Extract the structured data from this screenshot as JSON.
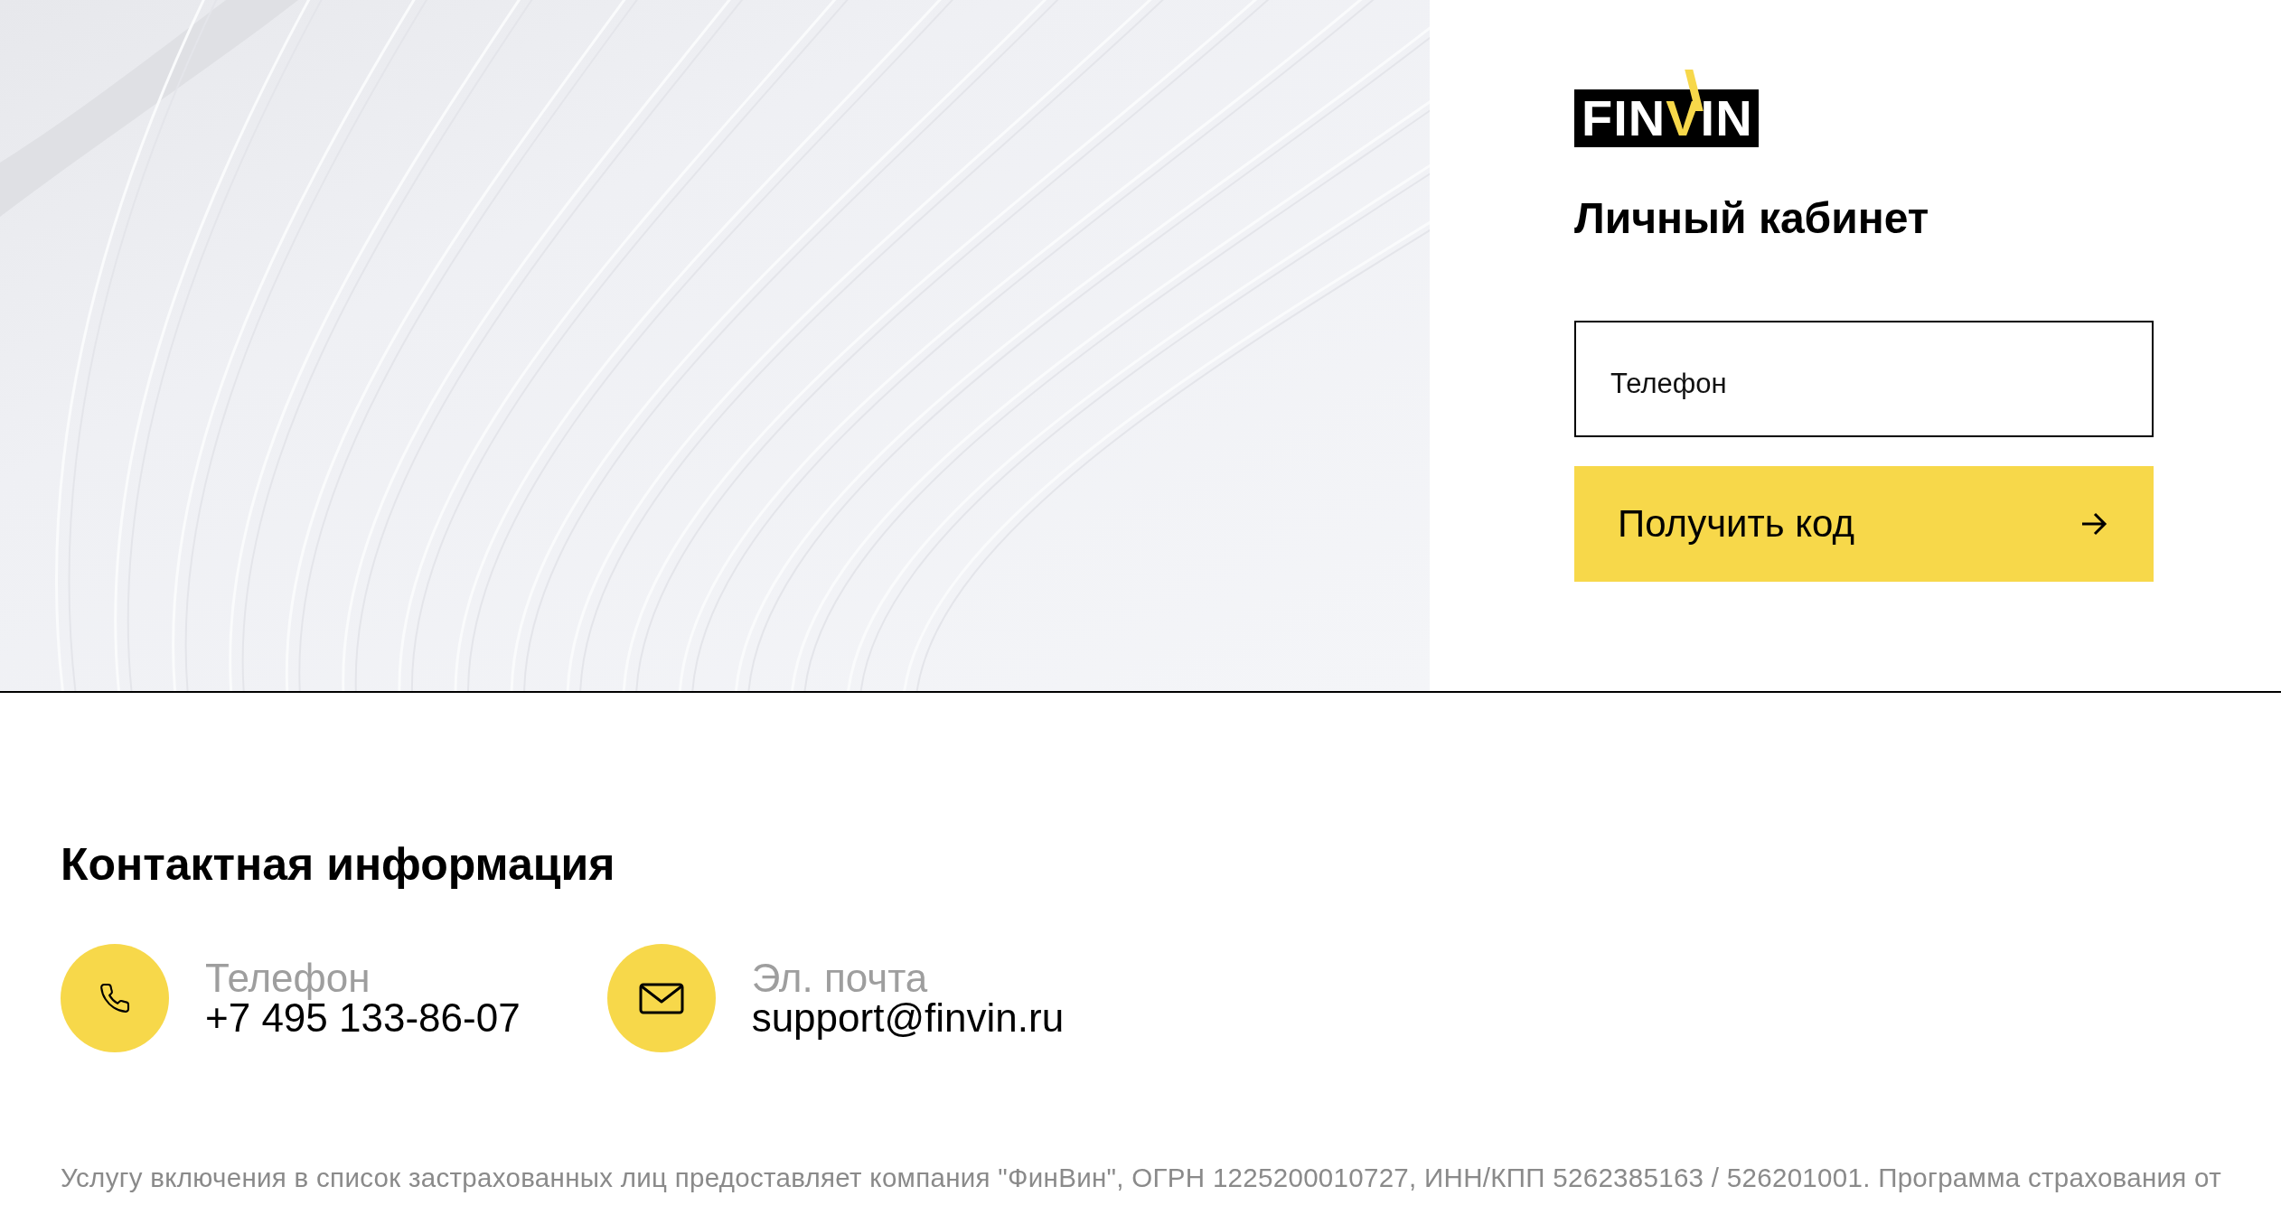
{
  "logo": {
    "parts": [
      {
        "text": "FIN",
        "accent": false
      },
      {
        "text": "V",
        "accent": true
      },
      {
        "text": "IN",
        "accent": false
      }
    ]
  },
  "title": "Личный кабинет",
  "phone_field": {
    "placeholder": "Телефон"
  },
  "submit_button": {
    "label": "Получить код"
  },
  "contacts": {
    "title": "Контактная информация",
    "items": [
      {
        "kind": "phone",
        "label": "Телефон",
        "value": "+7 495 133-86-07"
      },
      {
        "kind": "email",
        "label": "Эл. почта",
        "value": "support@finvin.ru"
      }
    ]
  },
  "footer_note": "Услугу включения в список застрахованных лиц предоставляет компания \"ФинВин\", ОГРН 1225200010727, ИНН/КПП 5262385163 / 526201001. Программа страхования от"
}
